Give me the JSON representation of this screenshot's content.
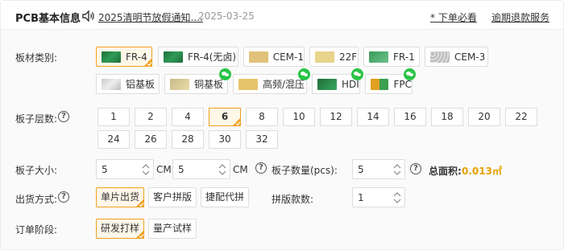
{
  "header": {
    "title": "PCB基本信息",
    "notice_text": "2025清明节放假通知....",
    "notice_date": "2025-03-25",
    "link_order_must_read": "* 下单必看",
    "link_overdue_refund": "逾期退款服务"
  },
  "material": {
    "label": "板材类别:",
    "options": [
      {
        "label": "FR-4",
        "selected": true,
        "icon": "green-board-icon",
        "wechat": false
      },
      {
        "label": "FR-4(无卤)",
        "selected": false,
        "icon": "green-board-icon",
        "wechat": false
      },
      {
        "label": "CEM-1",
        "selected": false,
        "icon": "yellow-board-icon",
        "wechat": false
      },
      {
        "label": "22F",
        "selected": false,
        "icon": "yellow-board-icon",
        "wechat": false
      },
      {
        "label": "FR-1",
        "selected": false,
        "icon": "green-board-icon",
        "wechat": false
      },
      {
        "label": "CEM-3",
        "selected": false,
        "icon": "gray-board-icon",
        "wechat": false
      },
      {
        "label": "铝基板",
        "selected": false,
        "icon": "aluminum-board-icon",
        "wechat": false
      },
      {
        "label": "铜基板",
        "selected": false,
        "icon": "copper-board-icon",
        "wechat": true
      },
      {
        "label": "高频/混压",
        "selected": false,
        "icon": "yellow-board-icon",
        "wechat": true
      },
      {
        "label": "HDI",
        "selected": false,
        "icon": "green-board-icon",
        "wechat": true
      },
      {
        "label": "FPC",
        "selected": false,
        "icon": "fpc-board-icon",
        "wechat": true
      }
    ]
  },
  "layers": {
    "label": "板子层数:",
    "options": [
      "1",
      "2",
      "4",
      "6",
      "8",
      "10",
      "12",
      "14",
      "16",
      "18",
      "20",
      "22",
      "24",
      "26",
      "28",
      "30",
      "32"
    ],
    "selected": "6"
  },
  "size": {
    "label": "板子大小:",
    "width_value": "5",
    "height_value": "5",
    "unit": "CM",
    "qty_label": "板子数量(pcs):",
    "qty_value": "5",
    "area_label": "总面积:",
    "area_value": "0.013㎡"
  },
  "shipping": {
    "label": "出货方式:",
    "options": [
      {
        "label": "单片出货",
        "selected": true
      },
      {
        "label": "客户拼版",
        "selected": false
      },
      {
        "label": "捷配代拼",
        "selected": false
      }
    ],
    "panel_count_label": "拼版款数:",
    "panel_count_value": "1"
  },
  "stage": {
    "label": "订单阶段:",
    "options": [
      {
        "label": "研发打样",
        "selected": true
      },
      {
        "label": "量产试样",
        "selected": false
      }
    ]
  },
  "colors": {
    "accent": "#f0a020",
    "selected_bg": "#fff7e8",
    "area_value": "#e8a000",
    "wechat_green": "#28c445"
  }
}
